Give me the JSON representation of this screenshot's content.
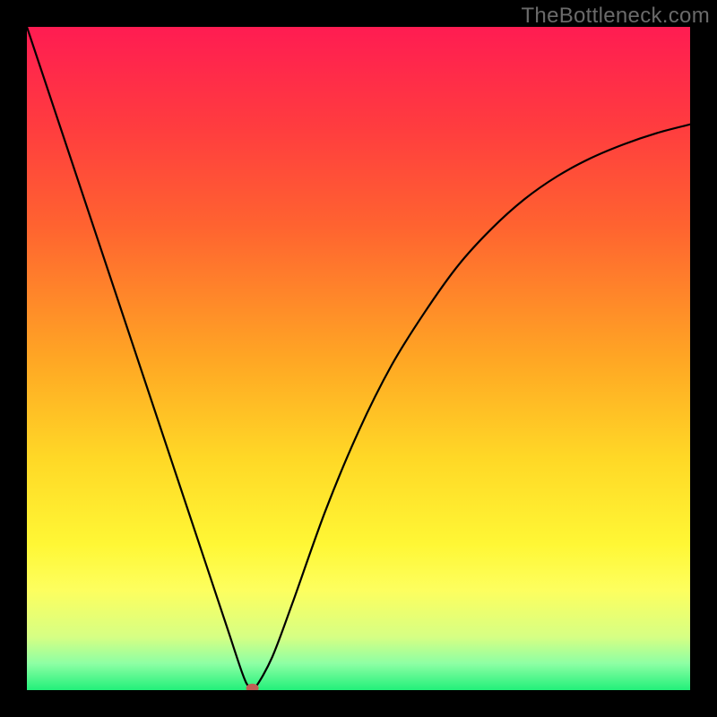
{
  "watermark": "TheBottleneck.com",
  "chart_data": {
    "type": "line",
    "title": "",
    "xlabel": "",
    "ylabel": "",
    "xlim": [
      0,
      100
    ],
    "ylim": [
      0,
      100
    ],
    "grid": false,
    "background_gradient": {
      "stops": [
        {
          "offset": 0.0,
          "color": "#ff1c52"
        },
        {
          "offset": 0.15,
          "color": "#ff3c3f"
        },
        {
          "offset": 0.3,
          "color": "#ff6330"
        },
        {
          "offset": 0.5,
          "color": "#ffa624"
        },
        {
          "offset": 0.65,
          "color": "#ffd826"
        },
        {
          "offset": 0.78,
          "color": "#fff735"
        },
        {
          "offset": 0.85,
          "color": "#fdff5f"
        },
        {
          "offset": 0.92,
          "color": "#d6ff84"
        },
        {
          "offset": 0.96,
          "color": "#8dffa4"
        },
        {
          "offset": 1.0,
          "color": "#22f07a"
        }
      ]
    },
    "series": [
      {
        "name": "bottleneck-curve",
        "color": "#000000",
        "x": [
          0,
          5,
          10,
          15,
          20,
          25,
          30,
          32.5,
          33.5,
          34.5,
          37,
          40,
          45,
          50,
          55,
          60,
          65,
          70,
          75,
          80,
          85,
          90,
          95,
          100
        ],
        "y": [
          100,
          85,
          70,
          55,
          40,
          25,
          10,
          2.5,
          0.5,
          0.5,
          5,
          13,
          27,
          39,
          49,
          57,
          64,
          69.5,
          74,
          77.5,
          80.2,
          82.3,
          84,
          85.3
        ]
      }
    ],
    "marker": {
      "name": "minimum-point",
      "x": 34,
      "y": 0.3,
      "color": "#c05e55",
      "rx": 7,
      "ry": 5
    }
  }
}
